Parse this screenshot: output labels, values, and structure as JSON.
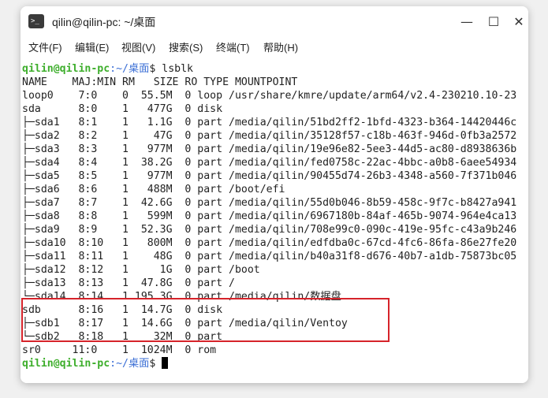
{
  "window": {
    "title": "qilin@qilin-pc: ~/桌面",
    "app_icon": ">_",
    "minimize": "—",
    "maximize": "☐",
    "close": "✕"
  },
  "menu": [
    "文件(F)",
    "编辑(E)",
    "视图(V)",
    "搜索(S)",
    "终端(T)",
    "帮助(H)"
  ],
  "prompt": {
    "user": "qilin@qilin-pc",
    "path": ":~/桌面",
    "symbol": "$ ",
    "command": "lsblk"
  },
  "output_lines": [
    "NAME    MAJ:MIN RM   SIZE RO TYPE MOUNTPOINT",
    "loop0    7:0    0  55.5M  0 loop /usr/share/kmre/update/arm64/v2.4-230210.10-23",
    "sda      8:0    1   477G  0 disk",
    "├─sda1   8:1    1   1.1G  0 part /media/qilin/51bd2ff2-1bfd-4323-b364-14420446c",
    "├─sda2   8:2    1    47G  0 part /media/qilin/35128f57-c18b-463f-946d-0fb3a2572",
    "├─sda3   8:3    1   977M  0 part /media/qilin/19e96e82-5ee3-44d5-ac80-d8938636b",
    "├─sda4   8:4    1  38.2G  0 part /media/qilin/fed0758c-22ac-4bbc-a0b8-6aee54934",
    "├─sda5   8:5    1   977M  0 part /media/qilin/90455d74-26b3-4348-a560-7f371b046",
    "├─sda6   8:6    1   488M  0 part /boot/efi",
    "├─sda7   8:7    1  42.6G  0 part /media/qilin/55d0b046-8b59-458c-9f7c-b8427a941",
    "├─sda8   8:8    1   599M  0 part /media/qilin/6967180b-84af-465b-9074-964e4ca13",
    "├─sda9   8:9    1  52.3G  0 part /media/qilin/708e99c0-090c-419e-95fc-c43a9b246",
    "├─sda10  8:10   1   800M  0 part /media/qilin/edfdba0c-67cd-4fc6-86fa-86e27fe20",
    "├─sda11  8:11   1    48G  0 part /media/qilin/b40a31f8-d676-40b7-a1db-75873bc05",
    "├─sda12  8:12   1     1G  0 part /boot",
    "├─sda13  8:13   1  47.8G  0 part /",
    "└─sda14  8:14   1 195.3G  0 part /media/qilin/数据盘",
    "sdb      8:16   1  14.7G  0 disk",
    "├─sdb1   8:17   1  14.6G  0 part /media/qilin/Ventoy",
    "└─sdb2   8:18   1    32M  0 part",
    "sr0     11:0    1  1024M  0 rom"
  ],
  "colors": {
    "prompt_user": "#3dae2b",
    "prompt_path": "#3b6fd6",
    "highlight": "#d6232a"
  }
}
